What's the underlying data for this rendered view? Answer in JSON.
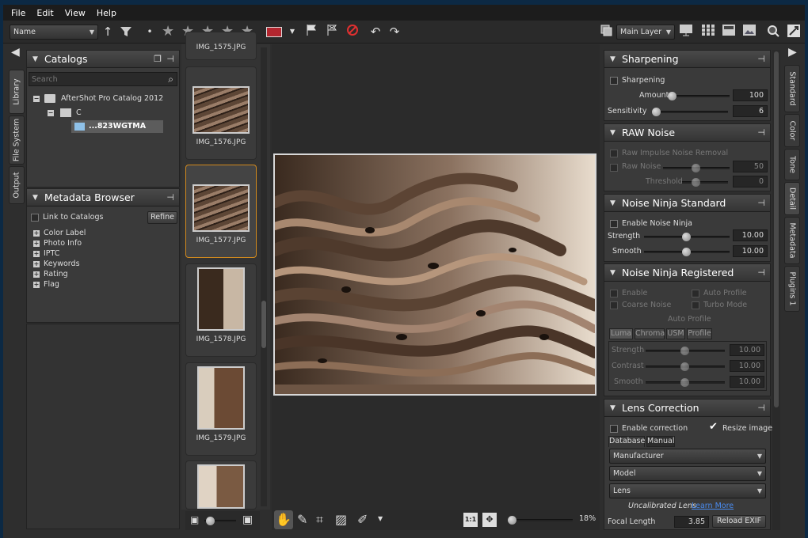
{
  "menu": [
    "File",
    "Edit",
    "View",
    "Help"
  ],
  "toolbar": {
    "sort_value": "Name",
    "layer_value": "Main Layer"
  },
  "left_tabs": [
    "Library",
    "File System",
    "Output"
  ],
  "right_tabs": [
    "Standard",
    "Color",
    "Tone",
    "Detail",
    "Metadata",
    "Plugins 1"
  ],
  "catalogs": {
    "title": "Catalogs",
    "search_placeholder": "Search",
    "tree": [
      "AfterShot Pro Catalog 2012",
      "C",
      "...823WGTMA"
    ]
  },
  "metadata": {
    "title": "Metadata Browser",
    "link_label": "Link to Catalogs",
    "refine": "Refine",
    "items": [
      "Color Label",
      "Photo Info",
      "IPTC",
      "Keywords",
      "Rating",
      "Flag"
    ]
  },
  "filmstrip": {
    "top_partial": "IMG_1575.JPG",
    "items": [
      "IMG_1576.JPG",
      "IMG_1577.JPG",
      "IMG_1578.JPG",
      "IMG_1579.JPG"
    ]
  },
  "viewer": {
    "zoom": "18%",
    "ratio_label": "1:1"
  },
  "sharpening": {
    "title": "Sharpening",
    "enable": "Sharpening",
    "amount_label": "Amount",
    "amount": "100",
    "sensitivity_label": "Sensitivity",
    "sensitivity": "6"
  },
  "raw_noise": {
    "title": "RAW Noise",
    "impulse": "Raw Impulse Noise Removal",
    "raw_noise_label": "Raw Noise",
    "raw_noise": "50",
    "threshold_label": "Threshold",
    "threshold": "0"
  },
  "ninja_std": {
    "title": "Noise Ninja Standard",
    "enable": "Enable Noise Ninja",
    "strength_label": "Strength",
    "strength": "10.00",
    "smooth_label": "Smooth",
    "smooth": "10.00"
  },
  "ninja_reg": {
    "title": "Noise Ninja Registered",
    "enable": "Enable",
    "auto_profile": "Auto Profile",
    "coarse": "Coarse Noise",
    "turbo": "Turbo Mode",
    "auto_profile_btn": "Auto Profile",
    "tabs": [
      "Luma",
      "Chroma",
      "USM",
      "Profile"
    ],
    "strength_label": "Strength",
    "strength": "10.00",
    "contrast_label": "Contrast",
    "contrast": "10.00",
    "smooth_label": "Smooth",
    "smooth": "10.00"
  },
  "lens": {
    "title": "Lens Correction",
    "enable": "Enable correction",
    "resize": "Resize image",
    "tabs": [
      "Database",
      "Manual"
    ],
    "manufacturer": "Manufacturer",
    "model": "Model",
    "lens": "Lens",
    "uncal": "Uncalibrated Lens",
    "learn": "Learn More",
    "focal_label": "Focal Length",
    "focal": "3.85",
    "reload": "Reload EXIF"
  }
}
